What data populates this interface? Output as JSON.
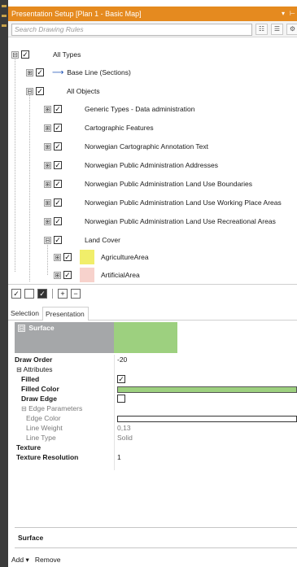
{
  "panel": {
    "title": "Presentation Setup [Plan 1 - Basic Map]",
    "title_buttons": [
      "▾",
      "⊢"
    ],
    "search_placeholder": "Search Drawing Rules"
  },
  "tree": [
    {
      "label": "All Types",
      "expander": "⊟",
      "checked": "✓"
    },
    {
      "label": "Base Line (Sections)",
      "expander": "⊞",
      "checked": "✓",
      "icon": "baseline-arrow-icon"
    },
    {
      "label": "All Objects",
      "expander": "⊟",
      "checked": "✓"
    },
    {
      "label": "Generic Types - Data administration",
      "expander": "⊞",
      "checked": "✓"
    },
    {
      "label": "Cartographic Features",
      "expander": "⊞",
      "checked": "✓"
    },
    {
      "label": "Norwegian Cartographic Annotation Text",
      "expander": "⊞",
      "checked": "✓"
    },
    {
      "label": "Norwegian Public Administration Addresses",
      "expander": "⊞",
      "checked": "✓"
    },
    {
      "label": "Norwegian Public Administration Land Use Boundaries",
      "expander": "⊞",
      "checked": "✓"
    },
    {
      "label": "Norwegian Public Administration Land Use Working Place Areas",
      "expander": "⊞",
      "checked": "✓"
    },
    {
      "label": "Norwegian Public Administration Land Use Recreational Areas",
      "expander": "⊞",
      "checked": "✓"
    },
    {
      "label": "Land Cover",
      "expander": "⊟",
      "checked": "✓"
    },
    {
      "label": "AgricultureArea",
      "expander": "⊞",
      "checked": "✓",
      "swatch": "#f1ee6a"
    },
    {
      "label": "ArtificialArea",
      "expander": "⊞",
      "checked": "✓",
      "swatch": "#f7d2cc"
    }
  ],
  "toolbar": {
    "b1": "✓",
    "b2": "",
    "b3": "✓",
    "b4": "+",
    "b5": "−"
  },
  "tabs": {
    "selection": "Selection",
    "presentation": "Presentation"
  },
  "properties": {
    "header": "Surface",
    "header_color": "#9dd07f",
    "draw_order_label": "Draw Order",
    "draw_order_value": "-20",
    "attributes_label": "Attributes",
    "filled_label": "Filled",
    "filled_value": "✓",
    "filled_color_label": "Filled Color",
    "filled_color_value": "#9dd07f",
    "draw_edge_label": "Draw Edge",
    "draw_edge_value": "",
    "edge_params_label": "Edge Parameters",
    "edge_color_label": "Edge Color",
    "line_weight_label": "Line Weight",
    "line_weight_value": "0,13",
    "line_type_label": "Line Type",
    "line_type_value": "Solid",
    "texture_label": "Texture",
    "texture_res_label": "Texture Resolution",
    "texture_res_value": "1"
  },
  "status": {
    "text": "Surface"
  },
  "bottom": {
    "add": "Add",
    "add_arrow": "▾",
    "remove": "Remove"
  }
}
